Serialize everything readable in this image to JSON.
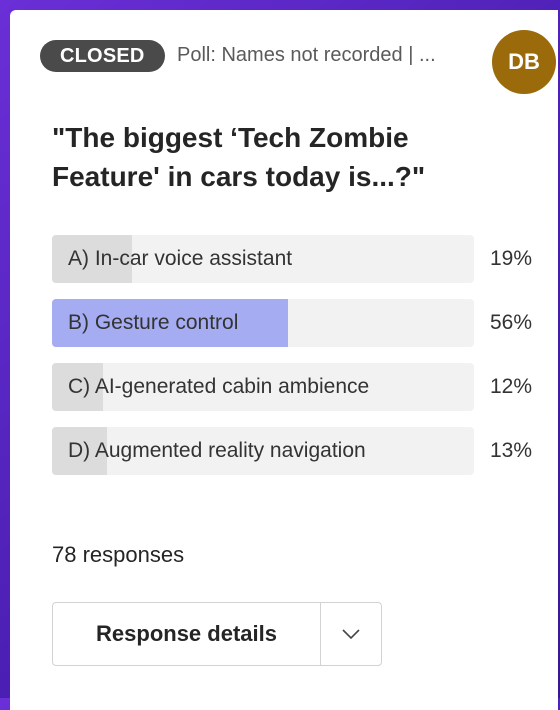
{
  "poll": {
    "status_badge": "CLOSED",
    "subtitle": "Poll: Names not recorded | ...",
    "avatar_initials": "DB",
    "avatar_color": "#9a6a0b",
    "question": "\"The biggest ‘Tech Zombie Feature' in cars today is...?\"",
    "options": [
      {
        "label": "A) In-car voice assistant",
        "percent_text": "19%",
        "percent": 19,
        "highlighted": false
      },
      {
        "label": "B) Gesture control",
        "percent_text": "56%",
        "percent": 56,
        "highlighted": true
      },
      {
        "label": "C) AI-generated cabin ambience",
        "percent_text": "12%",
        "percent": 12,
        "highlighted": false
      },
      {
        "label": "D) Augmented reality navigation",
        "percent_text": "13%",
        "percent": 13,
        "highlighted": false
      }
    ],
    "responses_text": "78 responses",
    "details_button_label": "Response details",
    "chevron_icon": "chevron-down-icon"
  },
  "colors": {
    "highlight_fill": "#a6acf2",
    "default_fill": "#dcdcdc",
    "bar_track": "#f2f2f2",
    "badge_bg": "#4a4a4a",
    "background": "#5b26c9"
  }
}
